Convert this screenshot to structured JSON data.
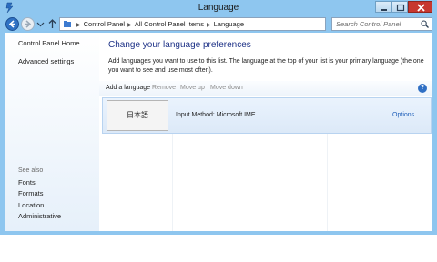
{
  "window": {
    "title": "Language"
  },
  "address_bar": {
    "crumbs": [
      "Control Panel",
      "All Control Panel Items",
      "Language"
    ],
    "search_placeholder": "Search Control Panel"
  },
  "sidebar": {
    "home": "Control Panel Home",
    "advanced": "Advanced settings",
    "see_also_heading": "See also",
    "see_also": [
      "Fonts",
      "Formats",
      "Location",
      "Administrative"
    ]
  },
  "main": {
    "title": "Change your language preferences",
    "description": "Add languages you want to use to this list. The language at the top of your list is your primary language (the one you want to see and use most often).",
    "toolbar": {
      "add": "Add a language",
      "remove": "Remove",
      "move_up": "Move up",
      "move_down": "Move down",
      "help": "?"
    },
    "languages": [
      {
        "name": "日本語",
        "input_method": "Input Method: Microsoft IME",
        "options": "Options..."
      }
    ]
  },
  "colors": {
    "frame": "#8ec6ef",
    "title_blue": "#1e3287",
    "link_blue": "#1e5eb8",
    "close_red": "#c7372f"
  },
  "icons": [
    "control-panel-icon",
    "minimize-icon",
    "maximize-icon",
    "close-icon",
    "back-arrow-icon",
    "forward-arrow-icon",
    "chevron-down-icon",
    "up-arrow-icon",
    "folder-icon",
    "refresh-icon",
    "search-icon",
    "help-icon"
  ]
}
